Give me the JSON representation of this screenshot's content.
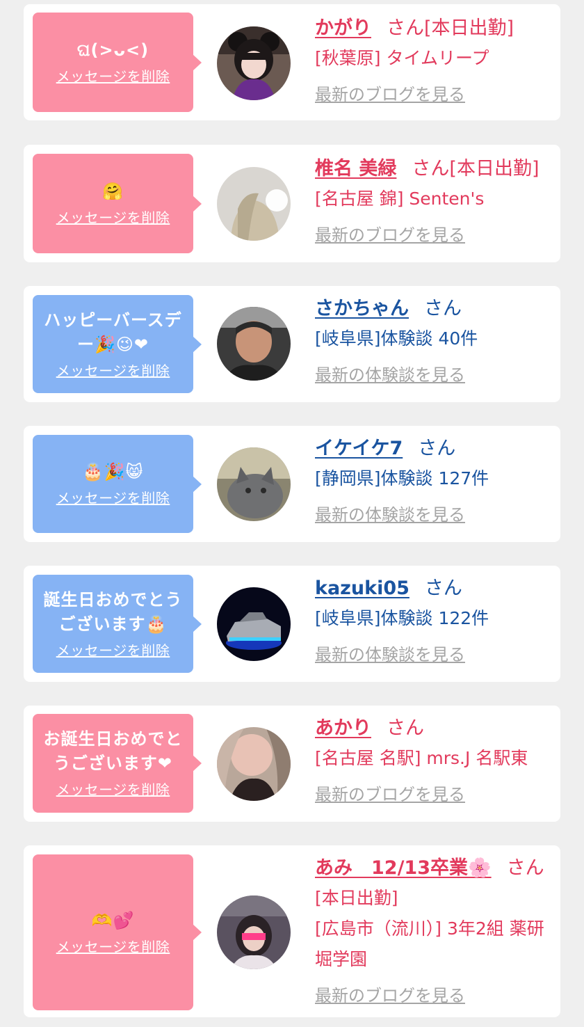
{
  "colors": {
    "pink_bubble": "#fb8fa4",
    "blue_bubble": "#86b3f4",
    "pink_text": "#e23a5c",
    "blue_text": "#1a54a0",
    "link_gray": "#a5a5a5",
    "background": "#efefef"
  },
  "cards": [
    {
      "message": "ଘ(>ᴗ<)",
      "delete_label": "メッセージを削除",
      "name": "かがり",
      "san": "さん",
      "badge": "[本日出勤]",
      "detail": "[秋葉原] タイムリープ",
      "link": "最新のブログを見る",
      "avatar_icon": "girl-avatar"
    },
    {
      "message": "🤗",
      "delete_label": "メッセージを削除",
      "name": "椎名 美緑",
      "san": "さん",
      "badge": "[本日出勤]",
      "detail": "[名古屋 錦] Senten's",
      "link": "最新のブログを見る",
      "avatar_icon": "girl-avatar"
    },
    {
      "message": "ハッピーバースデー🎉😉❤",
      "delete_label": "メッセージを削除",
      "name": "さかちゃん",
      "san": "さん",
      "detail": "[岐阜県]体験談 40件",
      "link": "最新の体験談を見る",
      "avatar_icon": "man-avatar"
    },
    {
      "message": "🎂🎉😸",
      "delete_label": "メッセージを削除",
      "name": "イケイケ7",
      "san": "さん",
      "detail": "[静岡県]体験談 127件",
      "link": "最新の体験談を見る",
      "avatar_icon": "cat-avatar"
    },
    {
      "message": "誕生日おめでとうございます🎂",
      "delete_label": "メッセージを削除",
      "name": "kazuki05",
      "san": "さん",
      "detail": "[岐阜県]体験談 122件",
      "link": "最新の体験談を見る",
      "avatar_icon": "car-avatar"
    },
    {
      "message": "お誕生日おめでとうございます❤",
      "delete_label": "メッセージを削除",
      "name": "あかり",
      "san": "さん",
      "detail": "[名古屋 名駅] mrs.J 名駅東",
      "link": "最新のブログを見る",
      "avatar_icon": "girl-avatar"
    },
    {
      "message": "🫶💕",
      "delete_label": "メッセージを削除",
      "name": "あみ　12/13卒業🌸",
      "san": "さん",
      "badge": "[本日出勤]",
      "detail": "[広島市（流川）] 3年2組 薬研堀学園",
      "link": "最新のブログを見る",
      "avatar_icon": "girl-avatar"
    }
  ]
}
